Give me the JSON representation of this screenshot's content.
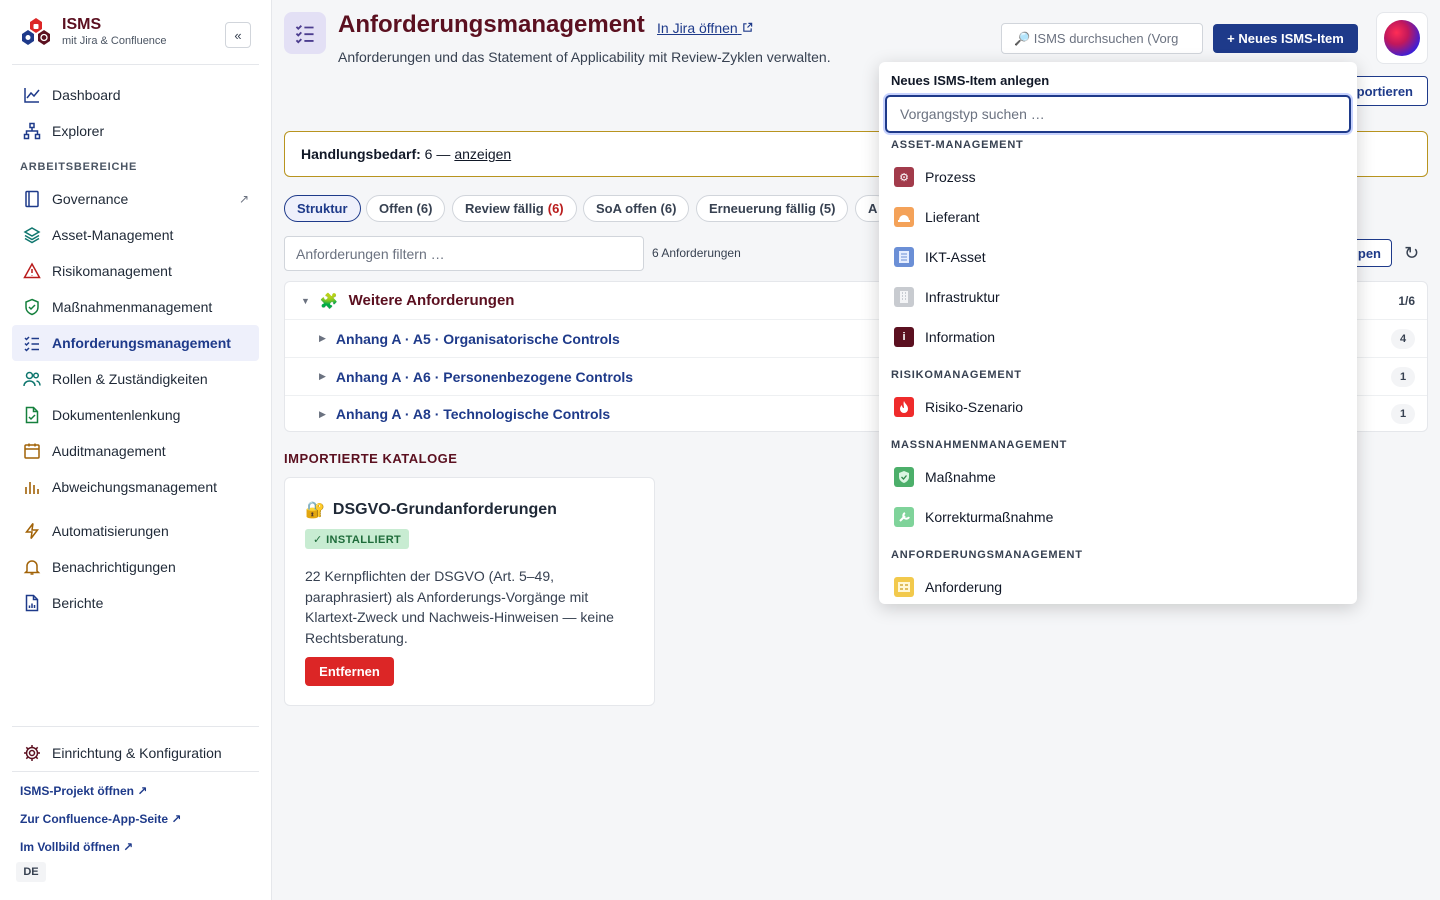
{
  "brand": {
    "title": "ISMS",
    "subtitle": "mit Jira & Confluence",
    "collapse": "«"
  },
  "nav": {
    "dashboard": "Dashboard",
    "explorer": "Explorer",
    "section_label": "ARBEITSBEREICHE",
    "governance": "Governance",
    "governance_ext": "↗",
    "asset": "Asset-Management",
    "risk": "Risikomanagement",
    "measures": "Maßnahmenmanagement",
    "requirements": "Anforderungsmanagement",
    "roles": "Rollen & Zuständigkeiten",
    "docs": "Dokumentenlenkung",
    "audit": "Auditmanagement",
    "deviation": "Abweichungsmanagement",
    "automation": "Automatisierungen",
    "notifications": "Benachrichtigungen",
    "reports": "Berichte",
    "setup": "Einrichtung & Konfiguration"
  },
  "footer_links": {
    "project": "ISMS-Projekt öffnen ↗",
    "confluence": "Zur Confluence-App-Seite ↗",
    "fullscreen": "Im Vollbild öffnen ↗",
    "lang": "DE"
  },
  "header": {
    "title": "Anforderungsmanagement",
    "jira_link": "In Jira öffnen",
    "subtitle": "Anforderungen und das Statement of Applicability mit Review-Zyklen verwalten.",
    "search_placeholder": "🔎 ISMS durchsuchen (Vorg",
    "new_button": "+ Neues ISMS-Item",
    "export_button": "portieren"
  },
  "alert": {
    "label": "Handlungsbedarf:",
    "value": "6 —",
    "link": "anzeigen"
  },
  "tabs": {
    "structure": "Struktur",
    "open": "Offen (6)",
    "review": "Review fällig",
    "review_count": "(6)",
    "soa": "SoA offen (6)",
    "renewal": "Erneuerung fällig (5)",
    "more": "A"
  },
  "filter": {
    "placeholder": "Anforderungen filtern …",
    "count": "6 Anforderungen",
    "open_btn": "pen"
  },
  "tree": {
    "group": {
      "title": "Weitere Anforderungen",
      "ratio": "1/6"
    },
    "rows": [
      {
        "label": "Anhang A · A5 · Organisatorische Controls",
        "count": "4"
      },
      {
        "label": "Anhang A · A6 · Personenbezogene Controls",
        "count": "1"
      },
      {
        "label": "Anhang A · A8 · Technologische Controls",
        "count": "1"
      }
    ]
  },
  "catalogs": {
    "heading": "IMPORTIERTE KATALOGE",
    "card": {
      "title": "DSGVO-Grundanforderungen",
      "badge": "✓ INSTALLIERT",
      "description": "22 Kernpflichten der DSGVO (Art. 5–49, paraphrasiert) als Anforderungs-Vorgänge mit Klartext-Zweck und Nachweis-Hinweisen — keine Rechtsberatung.",
      "remove": "Entfernen"
    }
  },
  "dropdown": {
    "title": "Neues ISMS-Item anlegen",
    "placeholder": "Vorgangstyp suchen …",
    "sections": {
      "asset": "ASSET-MANAGEMENT",
      "risk": "RISIKOMANAGEMENT",
      "measures": "MASSNAHMENMANAGEMENT",
      "requirements": "ANFORDERUNGSMANAGEMENT"
    },
    "items": {
      "process": "Prozess",
      "supplier": "Lieferant",
      "ict": "IKT-Asset",
      "infra": "Infrastruktur",
      "info": "Information",
      "risk_scenario": "Risiko-Szenario",
      "measure": "Maßnahme",
      "corrective": "Korrekturmaßnahme",
      "requirement": "Anforderung"
    }
  },
  "colors": {
    "brand": "#5b1020",
    "primary": "#1e3a8a",
    "danger": "#dc2626",
    "warning_border": "#b8941f"
  }
}
